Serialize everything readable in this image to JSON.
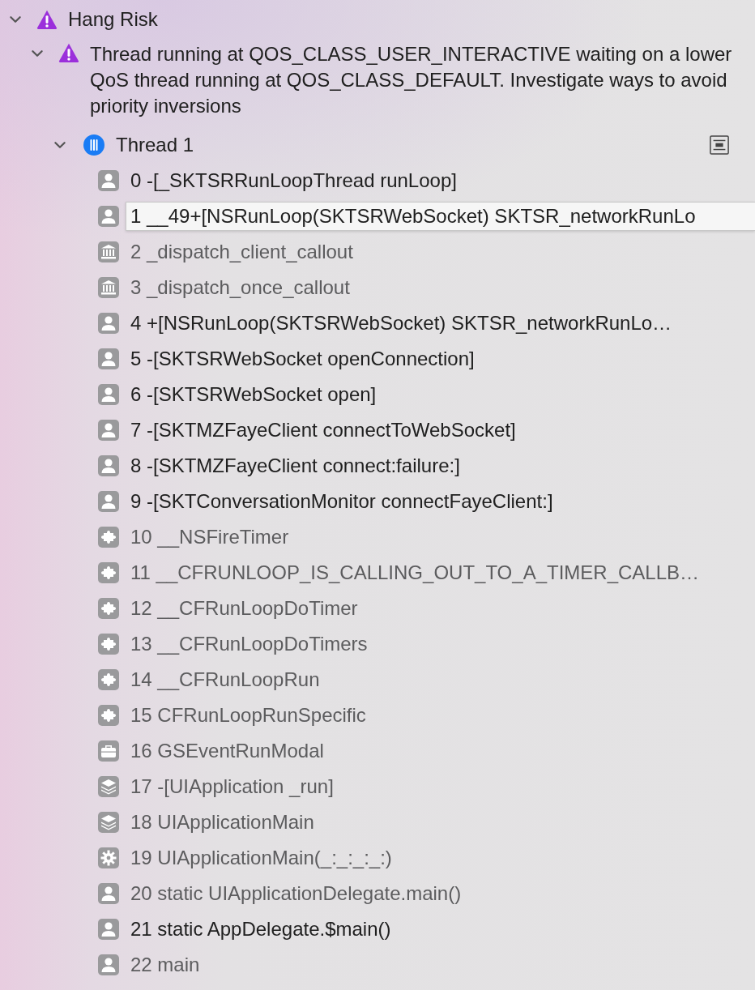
{
  "issue_group": {
    "title": "Hang Risk",
    "expanded": true,
    "issues": [
      {
        "title": "Thread running at QOS_CLASS_USER_INTERACTIVE waiting on a lower QoS thread running at QOS_CLASS_DEFAULT. Investigate ways to avoid priority inversions",
        "expanded": true,
        "threads": [
          {
            "name": "Thread 1",
            "expanded": true,
            "frames": [
              {
                "label": "0 -[_SKTSRRunLoopThread runLoop]",
                "kind": "user",
                "dimmed": false,
                "tooltip": false
              },
              {
                "label": "1 __49+[NSRunLoop(SKTSRWebSocket) SKTSR_networkRunLo",
                "kind": "user",
                "dimmed": false,
                "tooltip": true
              },
              {
                "label": "2 _dispatch_client_callout",
                "kind": "library",
                "dimmed": true,
                "tooltip": false
              },
              {
                "label": "3 _dispatch_once_callout",
                "kind": "library",
                "dimmed": true,
                "tooltip": false
              },
              {
                "label": "4 +[NSRunLoop(SKTSRWebSocket) SKTSR_networkRunLo…",
                "kind": "user",
                "dimmed": false,
                "tooltip": false
              },
              {
                "label": "5 -[SKTSRWebSocket openConnection]",
                "kind": "user",
                "dimmed": false,
                "tooltip": false
              },
              {
                "label": "6 -[SKTSRWebSocket open]",
                "kind": "user",
                "dimmed": false,
                "tooltip": false
              },
              {
                "label": "7 -[SKTMZFayeClient connectToWebSocket]",
                "kind": "user",
                "dimmed": false,
                "tooltip": false
              },
              {
                "label": "8 -[SKTMZFayeClient connect:failure:]",
                "kind": "user",
                "dimmed": false,
                "tooltip": false
              },
              {
                "label": "9 -[SKTConversationMonitor connectFayeClient:]",
                "kind": "user",
                "dimmed": false,
                "tooltip": false
              },
              {
                "label": "10 __NSFireTimer",
                "kind": "puzzle",
                "dimmed": true,
                "tooltip": false
              },
              {
                "label": "11 __CFRUNLOOP_IS_CALLING_OUT_TO_A_TIMER_CALLB…",
                "kind": "puzzle",
                "dimmed": true,
                "tooltip": false
              },
              {
                "label": "12 __CFRunLoopDoTimer",
                "kind": "puzzle",
                "dimmed": true,
                "tooltip": false
              },
              {
                "label": "13 __CFRunLoopDoTimers",
                "kind": "puzzle",
                "dimmed": true,
                "tooltip": false
              },
              {
                "label": "14 __CFRunLoopRun",
                "kind": "puzzle",
                "dimmed": true,
                "tooltip": false
              },
              {
                "label": "15 CFRunLoopRunSpecific",
                "kind": "puzzle",
                "dimmed": true,
                "tooltip": false
              },
              {
                "label": "16 GSEventRunModal",
                "kind": "toolbox",
                "dimmed": true,
                "tooltip": false
              },
              {
                "label": "17 -[UIApplication _run]",
                "kind": "stack",
                "dimmed": true,
                "tooltip": false
              },
              {
                "label": "18 UIApplicationMain",
                "kind": "stack",
                "dimmed": true,
                "tooltip": false
              },
              {
                "label": "19 UIApplicationMain(_:_:_:_:)",
                "kind": "gear",
                "dimmed": true,
                "tooltip": false
              },
              {
                "label": "20 static UIApplicationDelegate.main()",
                "kind": "user",
                "dimmed": true,
                "tooltip": false
              },
              {
                "label": "21 static AppDelegate.$main()",
                "kind": "user",
                "dimmed": false,
                "tooltip": false
              },
              {
                "label": "22 main",
                "kind": "user",
                "dimmed": true,
                "tooltip": false
              }
            ]
          }
        ]
      }
    ]
  }
}
